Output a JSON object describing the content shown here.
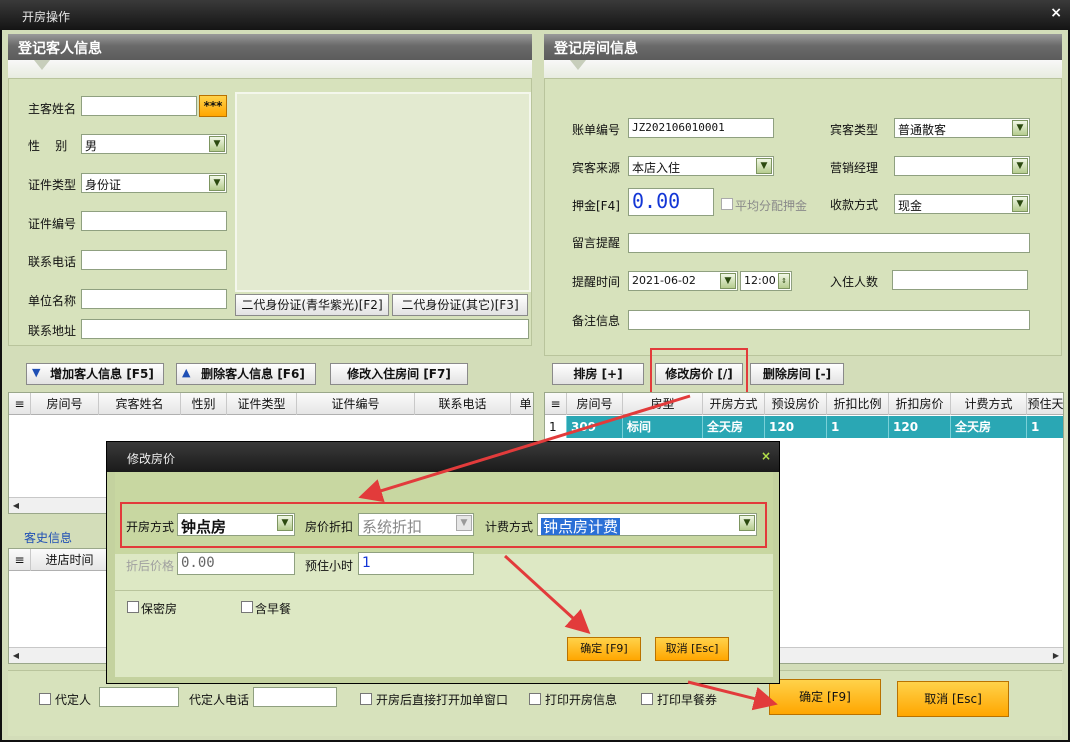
{
  "window": {
    "title": "开房操作",
    "close": "×"
  },
  "guest_panel": {
    "header": "登记客人信息",
    "labels": {
      "name": "主客姓名",
      "gender": "性    别",
      "id_type": "证件类型",
      "id_no": "证件编号",
      "phone": "联系电话",
      "company": "单位名称",
      "address": "联系地址"
    },
    "stars_button": "***",
    "gender_value": "男",
    "id_type_value": "身份证",
    "id_card_buttons": [
      "二代身份证(青华紫光)[F2]",
      "二代身份证(其它)[F3]"
    ]
  },
  "room_panel": {
    "header": "登记房间信息",
    "labels": {
      "bill_no": "账单编号",
      "guest_type": "宾客类型",
      "source": "宾客来源",
      "sales_mgr": "营销经理",
      "deposit": "押金[F4]",
      "avg_deposit": "平均分配押金",
      "pay_method": "收款方式",
      "message": "留言提醒",
      "remind_time": "提醒时间",
      "guests_count": "入住人数",
      "remarks": "备注信息"
    },
    "bill_no_value": "JZ202106010001",
    "guest_type_value": "普通散客",
    "source_value": "本店入住",
    "deposit_value": "0.00",
    "pay_method_value": "现金",
    "remind_date": "2021-06-02",
    "remind_clock": "12:00"
  },
  "left_toolbar": [
    "增加客人信息 [F5]",
    "删除客人信息 [F6]",
    "修改入住房间 [F7]"
  ],
  "right_toolbar": [
    "排房 [+]",
    "修改房价 [/]",
    "删除房间  [-]"
  ],
  "guest_grid": {
    "columns": [
      "房间号",
      "宾客姓名",
      "性别",
      "证件类型",
      "证件编号",
      "联系电话",
      "单"
    ]
  },
  "history": {
    "label": "客史信息",
    "columns": [
      "进店时间"
    ]
  },
  "room_grid": {
    "columns": [
      "房间号",
      "房型",
      "开房方式",
      "预设房价",
      "折扣比例",
      "折扣房价",
      "计费方式",
      "预住天"
    ],
    "rows": [
      {
        "idx": "1",
        "room": "309",
        "type": "标间",
        "mode": "全天房",
        "preset": "120",
        "ratio": "1",
        "disc": "120",
        "bill": "全天房",
        "days": "1"
      }
    ]
  },
  "dialog": {
    "title": "修改房价",
    "close": "×",
    "labels": {
      "open_mode": "开房方式",
      "discount": "房价折扣",
      "bill_mode": "计费方式",
      "after_price": "折后价格",
      "hours": "预住小时",
      "secret": "保密房",
      "breakfast": "含早餐"
    },
    "open_mode_value": "钟点房",
    "discount_value": "系统折扣",
    "bill_mode_value": "钟点房计费",
    "after_price_value": "0.00",
    "hours_value": "1",
    "ok": "确定 [F9]",
    "cancel": "取消 [Esc]"
  },
  "footer": {
    "agent": "代定人",
    "agent_phone": "代定人电话",
    "open_window": "开房后直接打开加单窗口",
    "print_open": "打印开房信息",
    "print_breakfast": "打印早餐券",
    "ok": "确定 [F9]",
    "cancel": "取消 [Esc]"
  },
  "colors": {
    "panel_bg": "#d7e2bc",
    "header_gray": "#6a6a6a",
    "orange_button": "#ffa600",
    "selected_row": "#2aa7b4",
    "annotation_red": "#e23b3b"
  }
}
